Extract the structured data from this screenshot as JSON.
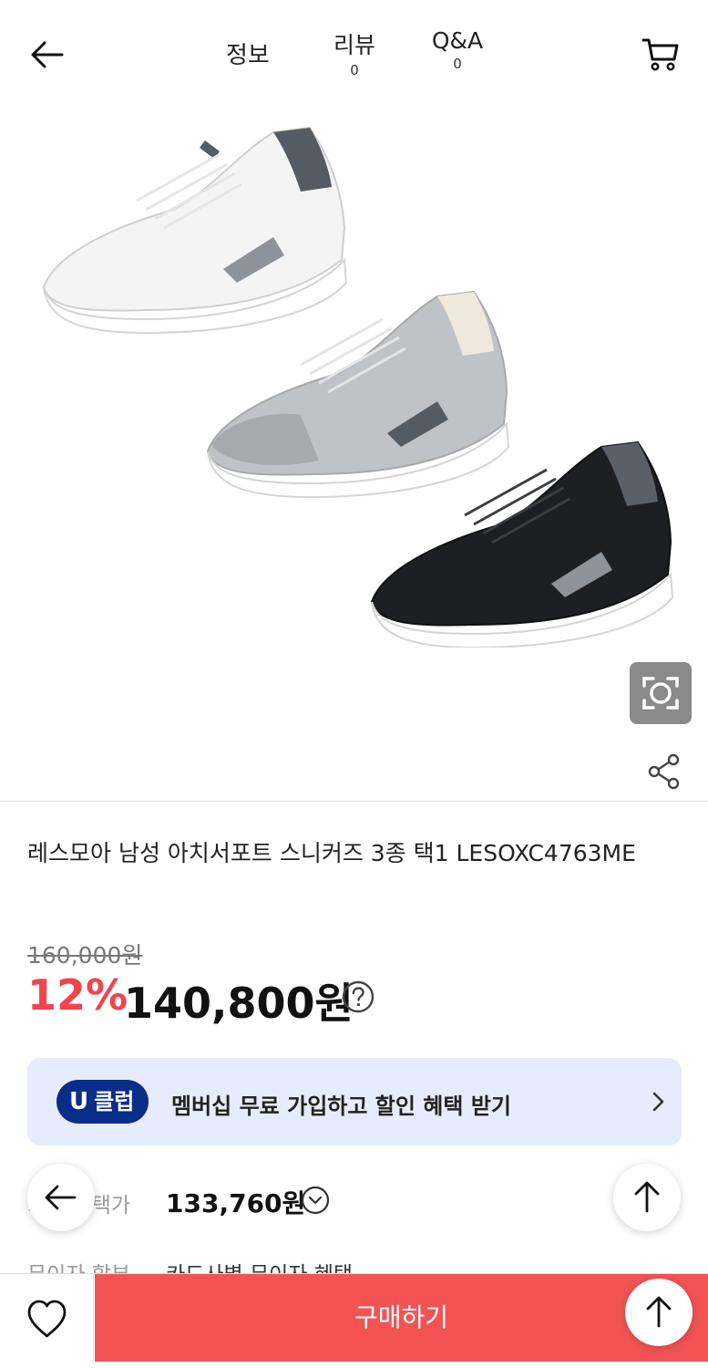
{
  "header": {
    "back_icon": "arrow-left-icon",
    "tabs": [
      {
        "label": "정보"
      },
      {
        "label": "리뷰",
        "count": "0"
      },
      {
        "label": "Q&A",
        "count": "0"
      }
    ],
    "cart_icon": "cart-icon"
  },
  "gallery": {
    "image_alt": "shoes-product-image",
    "lens_icon": "lens-search-icon",
    "share_icon": "share-icon"
  },
  "product": {
    "title": "레스모아 남성 아치서포트 스니커즈 3종 택1 LESOXC4763ME",
    "original_price": "160,000원",
    "discount": "12%",
    "sale_price": "140,800원"
  },
  "uclub": {
    "badge_u": "U",
    "badge_text": "클럽",
    "text": "멤버십 무료 가입하고 할인 혜택 받기"
  },
  "benefits": {
    "card_label": "카드 혜택가",
    "card_price": "133,760원",
    "install_label": "무이자 할부",
    "install_value": "카드사별 무이자 혜택"
  },
  "bottom": {
    "buy_label": "구매하기"
  },
  "colors": {
    "accent_red": "#f25454",
    "discount_red": "#f0454d",
    "uclub_bg": "#e6ecfb",
    "uclub_badge": "#0b2d8a"
  }
}
